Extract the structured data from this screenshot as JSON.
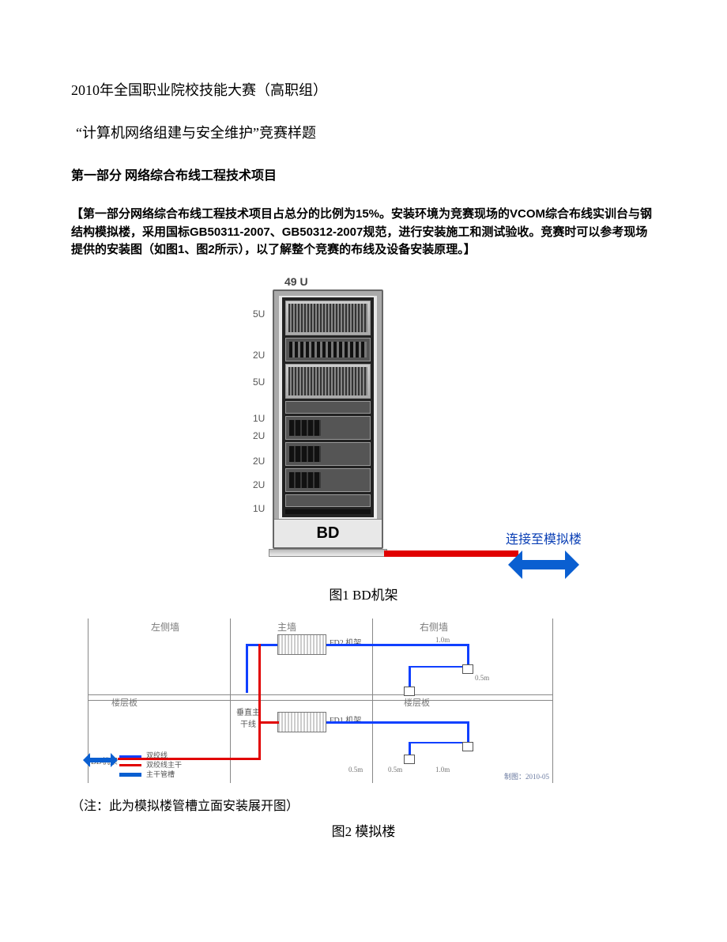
{
  "header": {
    "title": "2010年全国职业院校技能大赛（高职组）",
    "subtitle": "“计算机网络组建与安全维护”竞赛样题",
    "section": "第一部分 网络综合布线工程技术项目"
  },
  "intro": {
    "text": "【第一部分网络综合布线工程技术项目占总分的比例为15%。安装环境为竞赛现场的VCOM综合布线实训台与钢结构模拟楼，采用国标GB50311-2007、GB50312-2007规范，进行安装施工和测试验收。竞赛时可以参考现场提供的安装图（如图1、图2所示），以了解整个竞赛的布线及设备安装原理。】"
  },
  "fig1": {
    "rack_height": "49 U",
    "rack_name": "BD",
    "u_labels": [
      "5U",
      "2U",
      "5U",
      "1U",
      "2U",
      "2U",
      "2U",
      "1U"
    ],
    "arrow_label": "连接至模拟楼",
    "caption": "图1 BD机架"
  },
  "fig2": {
    "walls": {
      "left": "左侧墙",
      "main": "主墙",
      "right": "右侧墙"
    },
    "floor_label": "楼层板",
    "devices": {
      "fd1": "FD1 机架",
      "fd2": "FD2 机架"
    },
    "trunk_label": "垂直主干线",
    "bd_label": "BD机架",
    "legend": {
      "blue": "双绞线",
      "red": "双绞线主干",
      "arrow": "主干管槽"
    },
    "dims": [
      "0.5m",
      "1.0m",
      "0.5m",
      "0.5m",
      "1.0m"
    ],
    "corner": "制图：2010-05",
    "note": "（注：此为模拟楼管槽立面安装展开图）",
    "caption": "图2 模拟楼"
  }
}
